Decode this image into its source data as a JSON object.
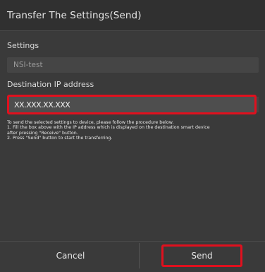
{
  "title": "Transfer The Settings(Send)",
  "settings": {
    "label": "Settings",
    "value": "NSI-test"
  },
  "destination": {
    "label": "Destination IP address",
    "value": "XX.XXX.XX.XXX"
  },
  "instructions": [
    "To send the selected settings to device, please follow the procedure below.",
    "1. Fill the box above with the IP address which is displayed on the destination smart device",
    "after pressing \"Receive\" button.",
    "2. Press \"Send\" button to start the transferring."
  ],
  "buttons": {
    "cancel": "Cancel",
    "send": "Send"
  },
  "colors": {
    "highlight": "#e0101e",
    "background": "#3a3a3a"
  }
}
